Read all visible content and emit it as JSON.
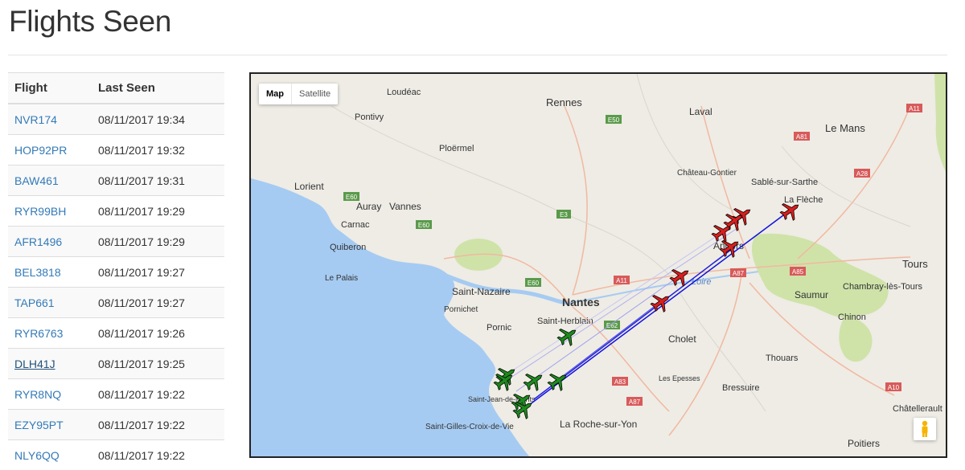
{
  "page": {
    "title": "Flights Seen"
  },
  "table": {
    "headers": [
      "Flight",
      "Last Seen"
    ],
    "rows": [
      {
        "flight": "NVR174",
        "last_seen": "08/11/2017 19:34"
      },
      {
        "flight": "HOP92PR",
        "last_seen": "08/11/2017 19:32"
      },
      {
        "flight": "BAW461",
        "last_seen": "08/11/2017 19:31"
      },
      {
        "flight": "RYR99BH",
        "last_seen": "08/11/2017 19:29"
      },
      {
        "flight": "AFR1496",
        "last_seen": "08/11/2017 19:29"
      },
      {
        "flight": "BEL3818",
        "last_seen": "08/11/2017 19:27"
      },
      {
        "flight": "TAP661",
        "last_seen": "08/11/2017 19:27"
      },
      {
        "flight": "RYR6763",
        "last_seen": "08/11/2017 19:26"
      },
      {
        "flight": "DLH41J",
        "last_seen": "08/11/2017 19:25"
      },
      {
        "flight": "RYR8NQ",
        "last_seen": "08/11/2017 19:22"
      },
      {
        "flight": "EZY95PT",
        "last_seen": "08/11/2017 19:22"
      },
      {
        "flight": "NLY6QQ",
        "last_seen": "08/11/2017 19:22"
      }
    ]
  },
  "map": {
    "type_buttons": [
      "Map",
      "Satellite"
    ],
    "active_type": "Map",
    "cities": [
      "Loudéac",
      "Rennes",
      "Laval",
      "Le Mans",
      "Pontivy",
      "Ploërmel",
      "Château-Gontier",
      "Sablé-sur-Sarthe",
      "Lorient",
      "La Flèche",
      "Auray",
      "Vannes",
      "Carnac",
      "Quiberon",
      "Angers",
      "Tours",
      "Le Palais",
      "Saint-Nazaire",
      "Nantes",
      "Saumur",
      "Chambray-lès-Tours",
      "Pornichet",
      "Saint-Herblain",
      "Chinon",
      "Pornic",
      "Cholet",
      "Thouars",
      "Les Epesses",
      "Bressuire",
      "Saint-Jean-de-Monts",
      "Châtellerault",
      "Saint-Gilles-Croix-de-Vie",
      "La Roche-sur-Yon",
      "Poitiers"
    ],
    "river_label": "Loire",
    "roads": [
      "E50",
      "A11",
      "A81",
      "A28",
      "E60",
      "E3",
      "A11",
      "A87",
      "A85",
      "E62",
      "A83",
      "A87",
      "A10",
      "E60",
      "E60"
    ],
    "colors": {
      "in_flight": "#d81e1e",
      "landed": "#1d8a1d",
      "track": "#1111dd",
      "water": "#a6cbf2",
      "land": "#eeece5"
    }
  }
}
